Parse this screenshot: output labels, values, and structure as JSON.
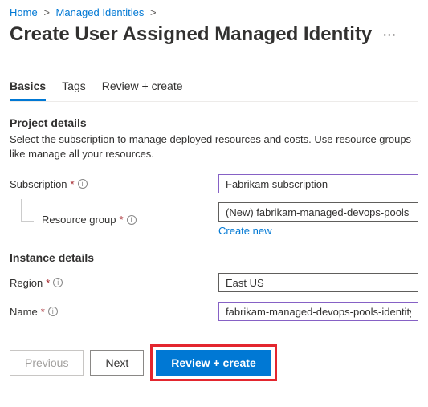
{
  "breadcrumb": {
    "home": "Home",
    "mi": "Managed Identities"
  },
  "title": "Create User Assigned Managed Identity",
  "tabs": {
    "basics": "Basics",
    "tags": "Tags",
    "review": "Review + create"
  },
  "project": {
    "heading": "Project details",
    "desc": "Select the subscription to manage deployed resources and costs. Use resource groups like manage all your resources.",
    "subscription_label": "Subscription",
    "subscription_value": "Fabrikam subscription",
    "rg_label": "Resource group",
    "rg_value": "(New) fabrikam-managed-devops-pools",
    "create_new": "Create new"
  },
  "instance": {
    "heading": "Instance details",
    "region_label": "Region",
    "region_value": "East US",
    "name_label": "Name",
    "name_value": "fabrikam-managed-devops-pools-identity"
  },
  "footer": {
    "previous": "Previous",
    "next": "Next",
    "review_create": "Review + create"
  }
}
